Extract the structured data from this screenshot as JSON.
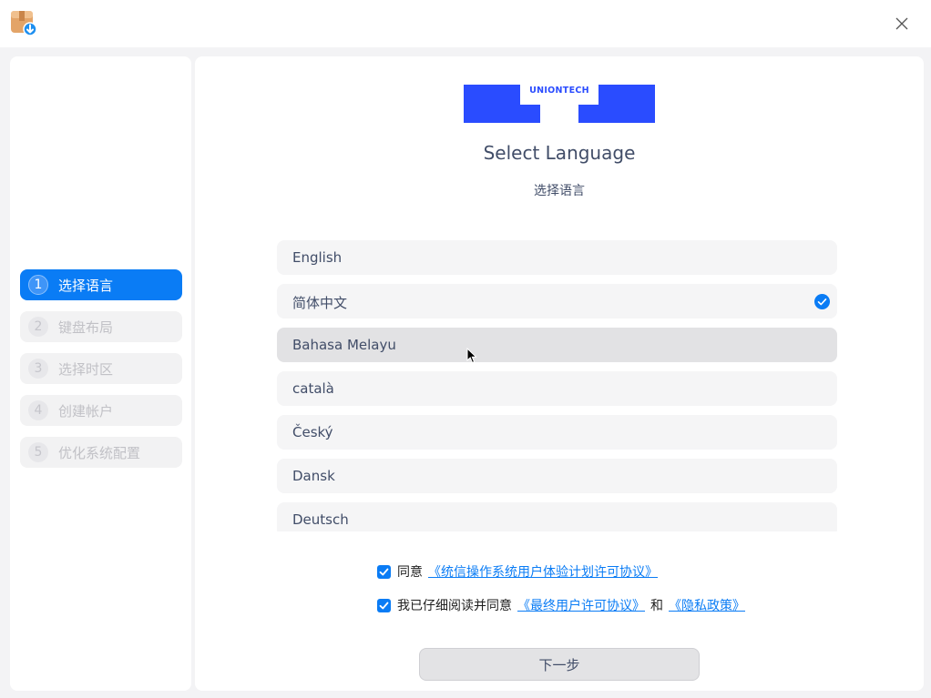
{
  "window": {
    "app_icon": "installer-package-icon",
    "close_icon": "close-icon"
  },
  "sidebar": {
    "steps": [
      {
        "num": "1",
        "label": "选择语言",
        "active": true
      },
      {
        "num": "2",
        "label": "键盘布局",
        "active": false
      },
      {
        "num": "3",
        "label": "选择时区",
        "active": false
      },
      {
        "num": "4",
        "label": "创建帐户",
        "active": false
      },
      {
        "num": "5",
        "label": "优化系统配置",
        "active": false
      }
    ]
  },
  "main": {
    "logo_text": "UNIONTECH",
    "title_en": "Select Language",
    "title_zh": "选择语言",
    "languages": [
      {
        "label": "English",
        "selected": false
      },
      {
        "label": "简体中文",
        "selected": true
      },
      {
        "label": "Bahasa Melayu",
        "selected": false,
        "hovered": true
      },
      {
        "label": "català",
        "selected": false
      },
      {
        "label": "Český",
        "selected": false
      },
      {
        "label": "Dansk",
        "selected": false
      },
      {
        "label": "Deutsch",
        "selected": false
      }
    ],
    "agreement1": {
      "checked": true,
      "prefix": "同意",
      "link": "《统信操作系统用户体验计划许可协议》"
    },
    "agreement2": {
      "checked": true,
      "prefix": "我已仔细阅读并同意",
      "link1": "《最终用户许可协议》",
      "conjunction": "和",
      "link2": "《隐私政策》"
    },
    "next_button": "下一步"
  },
  "colors": {
    "accent": "#0a7cf5",
    "logo_blue": "#2a4cff",
    "text": "#414d68"
  }
}
